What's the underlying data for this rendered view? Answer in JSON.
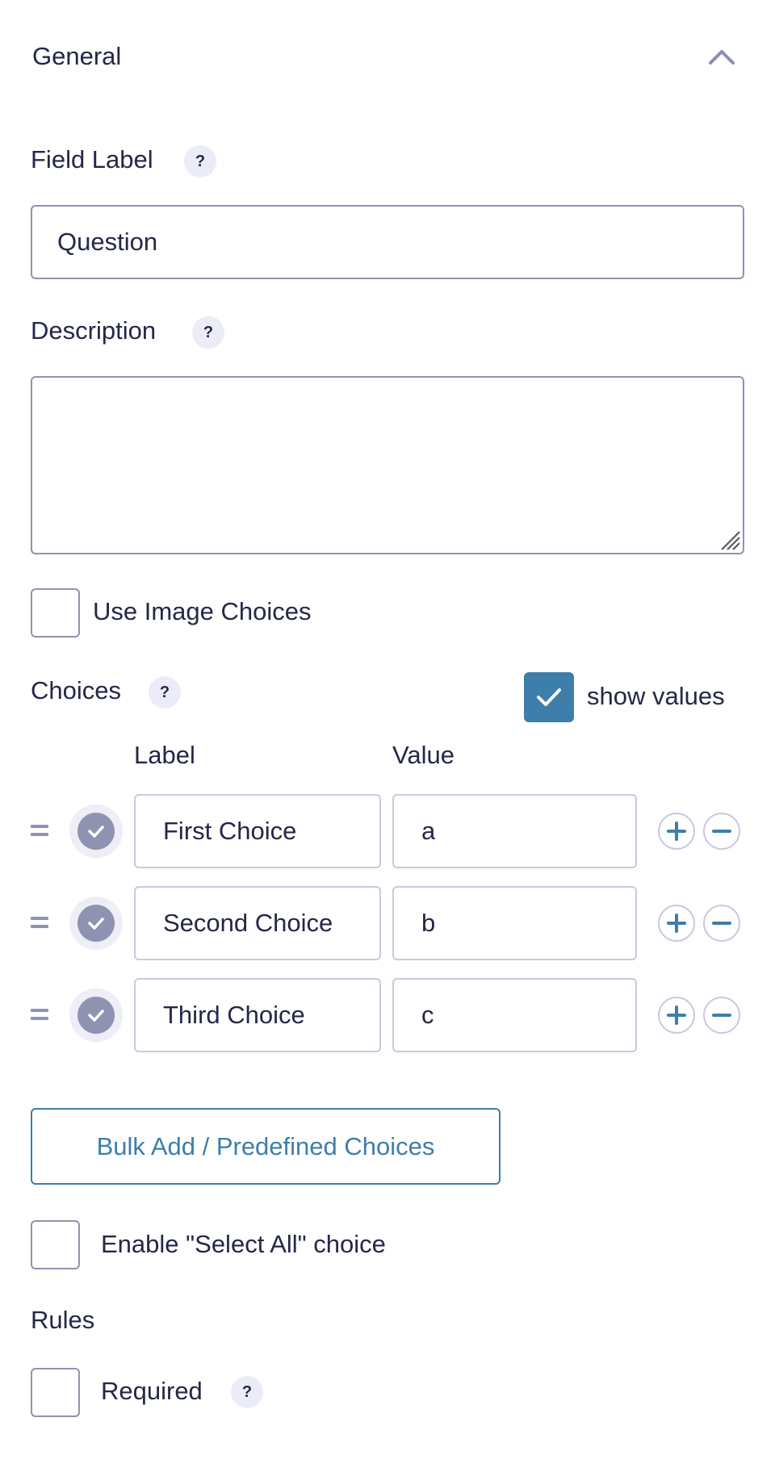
{
  "section": {
    "title": "General",
    "collapse_icon": "chevron-up-icon"
  },
  "field_label": {
    "label": "Field Label",
    "help": "?",
    "value": "Question"
  },
  "description": {
    "label": "Description",
    "help": "?",
    "value": ""
  },
  "use_image_choices": {
    "label": "Use Image Choices",
    "checked": false
  },
  "choices": {
    "label": "Choices",
    "help": "?",
    "show_values": {
      "label": "show values",
      "checked": true
    },
    "columns": {
      "label": "Label",
      "value": "Value"
    },
    "items": [
      {
        "label": "First Choice",
        "value": "a",
        "selected": true
      },
      {
        "label": "Second Choice",
        "value": "b",
        "selected": true
      },
      {
        "label": "Third Choice",
        "value": "c",
        "selected": true
      }
    ],
    "bulk_button": "Bulk Add / Predefined Choices"
  },
  "select_all": {
    "label": "Enable \"Select All\" choice",
    "checked": false
  },
  "rules": {
    "title": "Rules",
    "required": {
      "label": "Required",
      "help": "?",
      "checked": false
    }
  },
  "colors": {
    "accent": "#3e7eab",
    "text": "#242748",
    "border": "#9092b2",
    "help_bg": "#ececf8"
  }
}
